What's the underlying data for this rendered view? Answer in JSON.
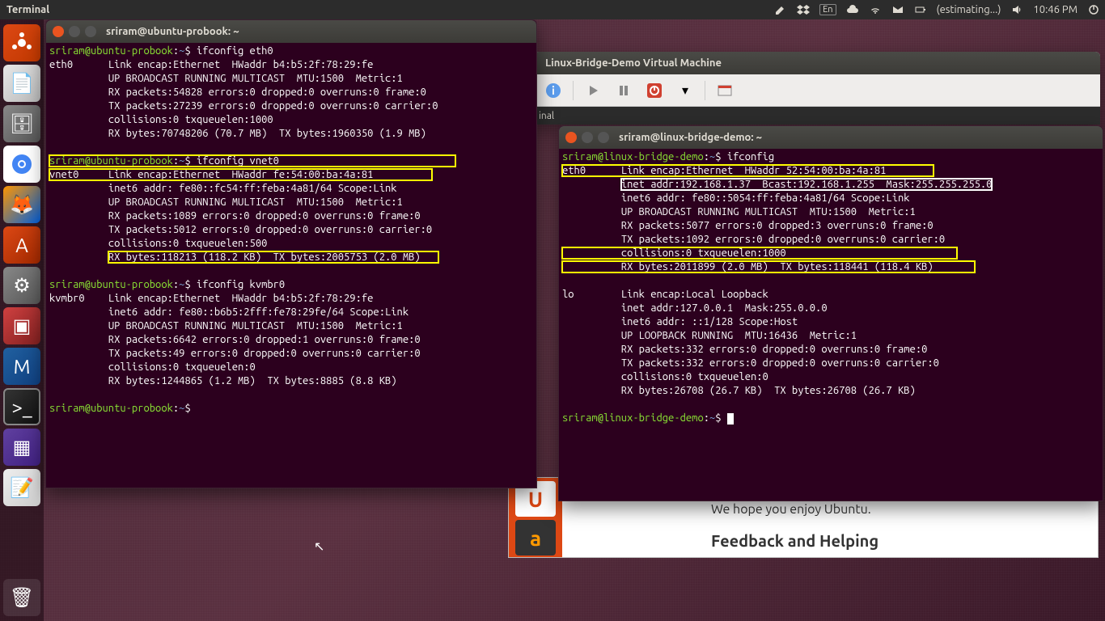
{
  "top_panel": {
    "app": "Terminal",
    "lang": "En",
    "battery": "(estimating...)",
    "time": "10:46 PM"
  },
  "vm_window": {
    "title": "Linux-Bridge-Demo Virtual Machine",
    "inner_label": "inal"
  },
  "welcome": {
    "line1": "We hope you enjoy Ubuntu.",
    "heading": "Feedback and Helping"
  },
  "term1": {
    "title": "sriram@ubuntu-probook: ~",
    "prompt_user": "sriram@ubuntu-probook",
    "prompt_path": "~",
    "cmd1": "ifconfig eth0",
    "eth0": {
      "iface": "eth0",
      "l1": "Link encap:Ethernet  HWaddr b4:b5:2f:78:29:fe",
      "l2": "UP BROADCAST RUNNING MULTICAST  MTU:1500  Metric:1",
      "l3": "RX packets:54828 errors:0 dropped:0 overruns:0 frame:0",
      "l4": "TX packets:27239 errors:0 dropped:0 overruns:0 carrier:0",
      "l5": "collisions:0 txqueuelen:1000",
      "l6": "RX bytes:70748206 (70.7 MB)  TX bytes:1960350 (1.9 MB)"
    },
    "cmd2": "ifconfig vnet0",
    "vnet0": {
      "iface": "vnet0",
      "l1": "Link encap:Ethernet  HWaddr fe:54:00:ba:4a:81",
      "l2": "inet6 addr: fe80::fc54:ff:feba:4a81/64 Scope:Link",
      "l3": "UP BROADCAST RUNNING MULTICAST  MTU:1500  Metric:1",
      "l4": "RX packets:1089 errors:0 dropped:0 overruns:0 frame:0",
      "l5": "TX packets:5012 errors:0 dropped:0 overruns:0 carrier:0",
      "l6": "collisions:0 txqueuelen:500",
      "l7": "RX bytes:118213 (118.2 KB)  TX bytes:2005753 (2.0 MB)"
    },
    "cmd3": "ifconfig kvmbr0",
    "kvmbr0": {
      "iface": "kvmbr0",
      "l1": "Link encap:Ethernet  HWaddr b4:b5:2f:78:29:fe",
      "l2": "inet6 addr: fe80::b6b5:2fff:fe78:29fe/64 Scope:Link",
      "l3": "UP BROADCAST RUNNING MULTICAST  MTU:1500  Metric:1",
      "l4": "RX packets:6642 errors:0 dropped:1 overruns:0 frame:0",
      "l5": "TX packets:49 errors:0 dropped:0 overruns:0 carrier:0",
      "l6": "collisions:0 txqueuelen:0",
      "l7": "RX bytes:1244865 (1.2 MB)  TX bytes:8885 (8.8 KB)"
    }
  },
  "term2": {
    "title": "sriram@linux-bridge-demo: ~",
    "prompt_user": "sriram@linux-bridge-demo",
    "prompt_path": "~",
    "cmd1": "ifconfig",
    "eth0": {
      "iface": "eth0",
      "l1": "Link encap:Ethernet  HWaddr 52:54:00:ba:4a:81",
      "l2": "inet addr:192.168.1.37  Bcast:192.168.1.255  Mask:255.255.255.0",
      "l3": "inet6 addr: fe80::5054:ff:feba:4a81/64 Scope:Link",
      "l4": "UP BROADCAST RUNNING MULTICAST  MTU:1500  Metric:1",
      "l5": "RX packets:5077 errors:0 dropped:3 overruns:0 frame:0",
      "l6": "TX packets:1092 errors:0 dropped:0 overruns:0 carrier:0",
      "l7": "collisions:0 txqueuelen:1000",
      "l8": "RX bytes:2011899 (2.0 MB)  TX bytes:118441 (118.4 KB)"
    },
    "lo": {
      "iface": "lo",
      "l1": "Link encap:Local Loopback",
      "l2": "inet addr:127.0.0.1  Mask:255.0.0.0",
      "l3": "inet6 addr: ::1/128 Scope:Host",
      "l4": "UP LOOPBACK RUNNING  MTU:16436  Metric:1",
      "l5": "RX packets:332 errors:0 dropped:0 overruns:0 frame:0",
      "l6": "TX packets:332 errors:0 dropped:0 overruns:0 carrier:0",
      "l7": "collisions:0 txqueuelen:0",
      "l8": "RX bytes:26708 (26.7 KB)  TX bytes:26708 (26.7 KB)"
    }
  }
}
